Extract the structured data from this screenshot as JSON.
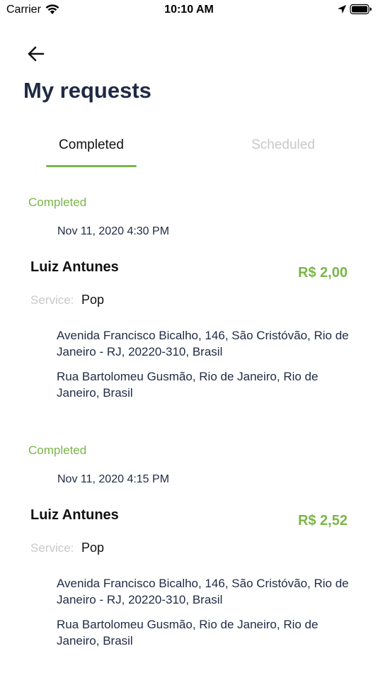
{
  "status_bar": {
    "carrier": "Carrier",
    "time": "10:10 AM",
    "icons": [
      "wifi-icon",
      "location-arrow-icon",
      "battery-icon"
    ]
  },
  "header": {
    "back_icon": "arrow-left-icon",
    "title": "My requests"
  },
  "tabs": [
    {
      "label": "Completed",
      "active": true
    },
    {
      "label": "Scheduled",
      "active": false
    }
  ],
  "requests": [
    {
      "status": "Completed",
      "datetime": "Nov 11, 2020 4:30 PM",
      "name": "Luiz Antunes",
      "price": "R$ 2,00",
      "service_label": "Service:",
      "service": "Pop",
      "origin": "Avenida Francisco Bicalho, 146, São Cristóvão, Rio de Janeiro - RJ, 20220-310, Brasil",
      "destination": "Rua Bartolomeu Gusmão, Rio de Janeiro, Rio de Janeiro, Brasil"
    },
    {
      "status": "Completed",
      "datetime": "Nov 11, 2020 4:15 PM",
      "name": "Luiz Antunes",
      "price": "R$ 2,52",
      "service_label": "Service:",
      "service": "Pop",
      "origin": "Avenida Francisco Bicalho, 146, São Cristóvão, Rio de Janeiro - RJ, 20220-310, Brasil",
      "destination": "Rua Bartolomeu Gusmão, Rio de Janeiro, Rio de Janeiro, Brasil"
    }
  ],
  "colors": {
    "accent": "#7ab648",
    "title": "#1f2a44",
    "muted": "#c8c8c8"
  }
}
